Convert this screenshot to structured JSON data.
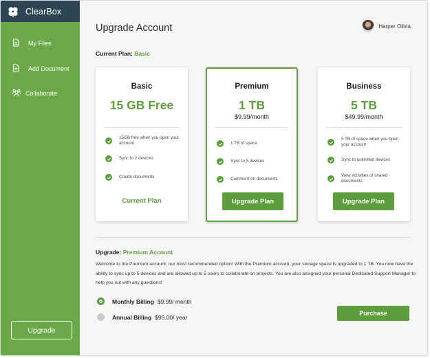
{
  "app": {
    "name": "ClearBox",
    "logo_icon": "clover-icon"
  },
  "sidebar": {
    "items": [
      {
        "label": "My Files",
        "icon": "document-icon"
      },
      {
        "label": "Add Document",
        "icon": "add-document-icon"
      },
      {
        "label": "Collaborate",
        "icon": "people-icon"
      }
    ],
    "upgrade_label": "Upgrade"
  },
  "header": {
    "title": "Upgrade Account",
    "user_name": "Harper Olivia"
  },
  "current_plan": {
    "label": "Current Plan:",
    "value": "Basic"
  },
  "plans": [
    {
      "name": "Basic",
      "size": "15 GB Free",
      "price": "",
      "features": [
        "15GB free when you open your account",
        "Sync to 2 devices",
        "Create documents"
      ],
      "action": "Current Plan"
    },
    {
      "name": "Premium",
      "size": "1 TB",
      "price": "$9.99/month",
      "features": [
        "1 TB of space",
        "Sync to 5 devices",
        "Comment on documents"
      ],
      "action": "Upgrade Plan"
    },
    {
      "name": "Business",
      "size": "5 TB",
      "price": "$49.99/month",
      "features": [
        "5 TB of space when you open your account",
        "Sync to unlimited devices",
        "View activities of shared documents"
      ],
      "action": "Upgrade Plan"
    }
  ],
  "upgrade": {
    "label": "Upgrade:",
    "plan": "Premium Account",
    "description": "Welcome to the Premium account, our most recommended option! With the Premium account, your storage space is upgraded to 1 TB. You now have the ability to sync up to 5 devices and are allowed up to 5 users to collaborate on projects. You are also assigned your personal Dedicated Support Manager to help you out with any questions!"
  },
  "billing": {
    "options": [
      {
        "label": "Monthly Billing",
        "price": "$9.99/ month",
        "selected": true
      },
      {
        "label": "Annual Billing",
        "price": "$95.00/ year",
        "selected": false
      }
    ],
    "purchase_label": "Purchase"
  },
  "colors": {
    "sidebar": "#6aa947",
    "logo_bar": "#2e4654",
    "accent": "#5c9e3b"
  }
}
